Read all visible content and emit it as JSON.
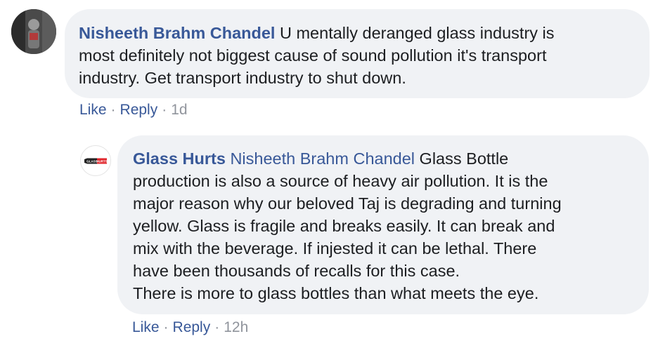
{
  "comment": {
    "author": "Nisheeth Brahm Chandel",
    "text_line1": " U mentally deranged glass industry is",
    "text_line2": "most definitely not biggest cause of sound pollution it's transport",
    "text_line3": "industry. Get transport industry to shut down.",
    "actions": {
      "like": "Like",
      "reply": "Reply",
      "separator": "·",
      "time": "1d"
    }
  },
  "reply": {
    "author": "Glass Hurts",
    "mention": "Nisheeth Brahm Chandel",
    "lines": [
      " Glass Bottle",
      "production is also a source of heavy air pollution. It is the",
      "major reason why our beloved Taj is degrading and turning",
      "yellow. Glass is fragile and breaks easily. It can break and",
      "mix with the beverage. If injested it can be lethal. There",
      "have been thousands of recalls for this case.",
      "There is more to glass bottles than what meets the eye."
    ],
    "avatar_logo_text": "GLASS HURTS",
    "actions": {
      "like": "Like",
      "reply": "Reply",
      "separator": "·",
      "time": "12h"
    }
  },
  "colors": {
    "link": "#385898",
    "bubble": "#f0f2f5",
    "meta": "#90949c",
    "logo_red": "#e0252b"
  }
}
